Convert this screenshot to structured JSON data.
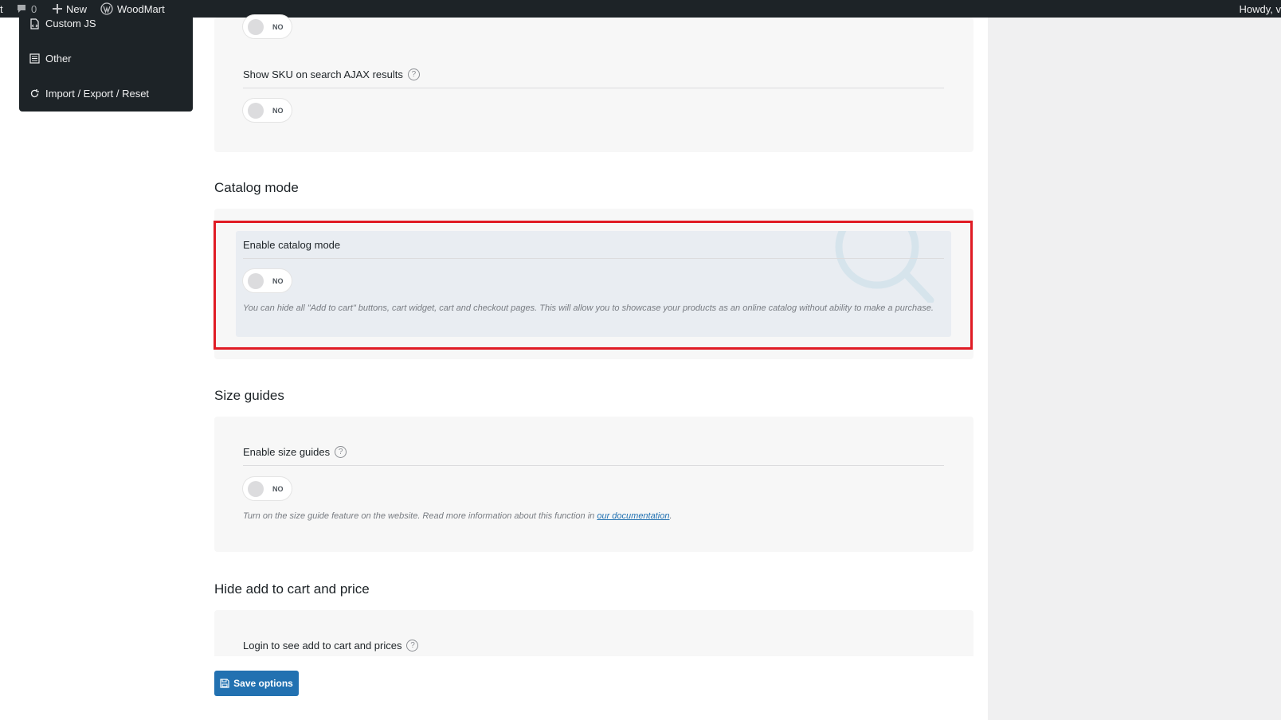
{
  "adminbar": {
    "cut_label": "t",
    "comments_count": "0",
    "new_label": "New",
    "site_label": "WoodMart",
    "howdy": "Howdy, v"
  },
  "sidemenu": {
    "items": [
      {
        "label": "Custom JS",
        "icon": "file-code-icon"
      },
      {
        "label": "Other",
        "icon": "sliders-icon"
      },
      {
        "label": "Import / Export / Reset",
        "icon": "refresh-icon"
      }
    ]
  },
  "search_section": {
    "top_toggle": "NO",
    "sku_label": "Show SKU on search AJAX results",
    "sku_toggle": "NO"
  },
  "catalog": {
    "title": "Catalog mode",
    "enable_label": "Enable catalog mode",
    "toggle": "NO",
    "description": "You can hide all \"Add to cart\" buttons, cart widget, cart and checkout pages. This will allow you to showcase your products as an online catalog without ability to make a purchase."
  },
  "size_guides": {
    "title": "Size guides",
    "enable_label": "Enable size guides",
    "toggle": "NO",
    "description_prefix": "Turn on the size guide feature on the website. Read more information about this function in ",
    "link_text": "our documentation",
    "description_suffix": "."
  },
  "hide_cart": {
    "title": "Hide add to cart and price",
    "login_label": "Login to see add to cart and prices"
  },
  "save_button": "Save options",
  "colors": {
    "accent": "#2271b1",
    "highlight": "#e01b24",
    "adminbar": "#1d2327"
  }
}
